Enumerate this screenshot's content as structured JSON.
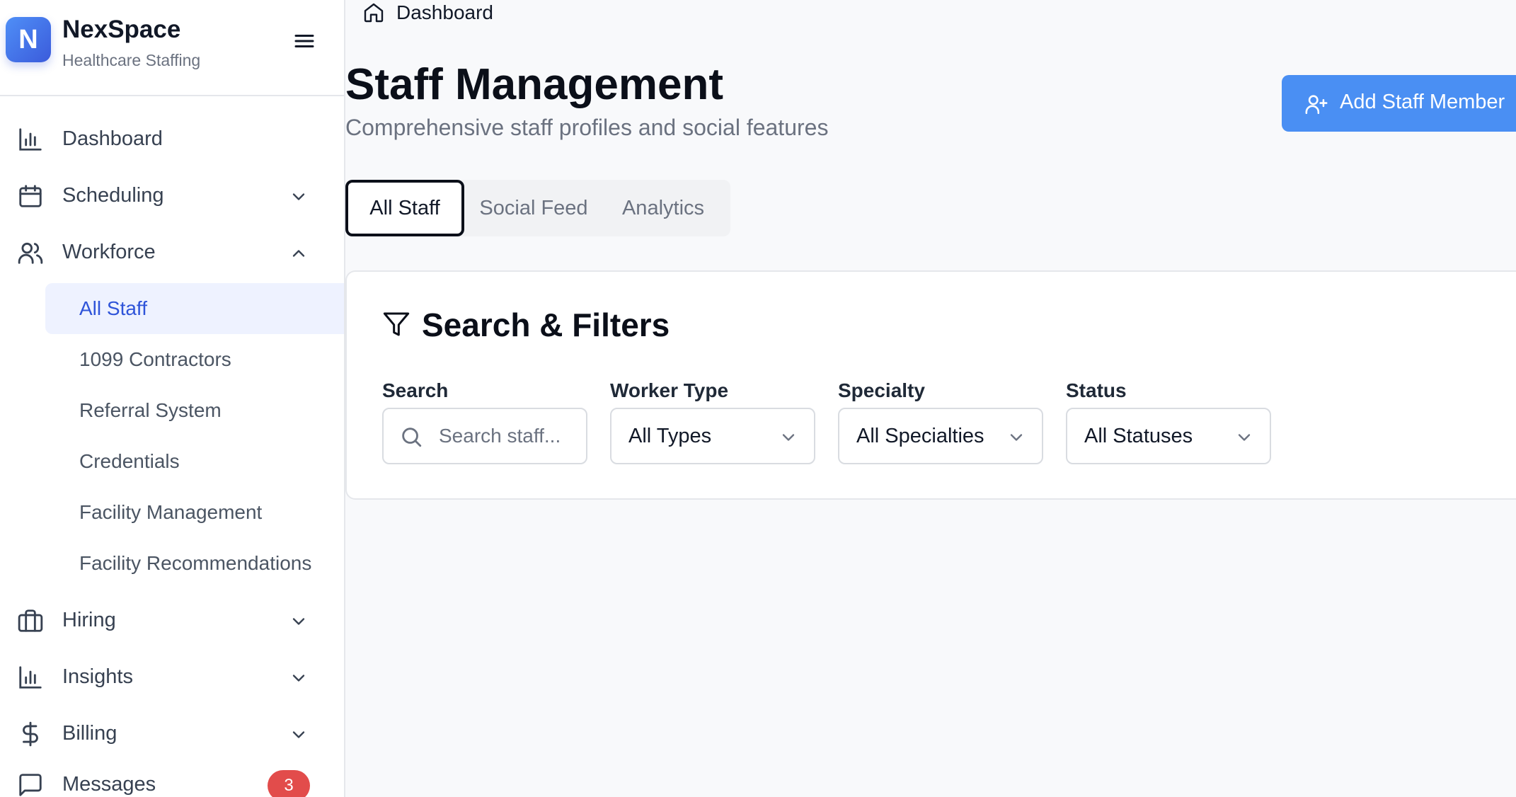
{
  "brand": {
    "logo_letter": "N",
    "name": "NexSpace",
    "subtitle": "Healthcare Staffing"
  },
  "sidebar": {
    "items": [
      {
        "label": "Dashboard",
        "icon": "bar-chart-icon"
      },
      {
        "label": "Scheduling",
        "icon": "calendar-icon"
      },
      {
        "label": "Workforce",
        "icon": "users-icon"
      },
      {
        "label": "Hiring",
        "icon": "briefcase-icon"
      },
      {
        "label": "Insights",
        "icon": "bar-chart-icon"
      },
      {
        "label": "Billing",
        "icon": "dollar-icon"
      },
      {
        "label": "Messages",
        "icon": "message-icon",
        "badge": "3"
      }
    ],
    "workforce_sub": [
      "All Staff",
      "1099 Contractors",
      "Referral System",
      "Credentials",
      "Facility Management",
      "Facility Recommendations"
    ]
  },
  "breadcrumb": {
    "label": "Dashboard"
  },
  "page": {
    "title": "Staff Management",
    "subtitle": "Comprehensive staff profiles and social features",
    "add_button": "Add Staff Member"
  },
  "tabs": [
    "All Staff",
    "Social Feed",
    "Analytics"
  ],
  "filters": {
    "title": "Search & Filters",
    "search_label": "Search",
    "search_placeholder": "Search staff...",
    "worker_type_label": "Worker Type",
    "worker_type_value": "All Types",
    "specialty_label": "Specialty",
    "specialty_value": "All Specialties",
    "status_label": "Status",
    "status_value": "All Statuses"
  },
  "colors": {
    "accent": "#4a8ff3",
    "active_nav": "#2f54d9",
    "badge": "#e24c4b"
  }
}
